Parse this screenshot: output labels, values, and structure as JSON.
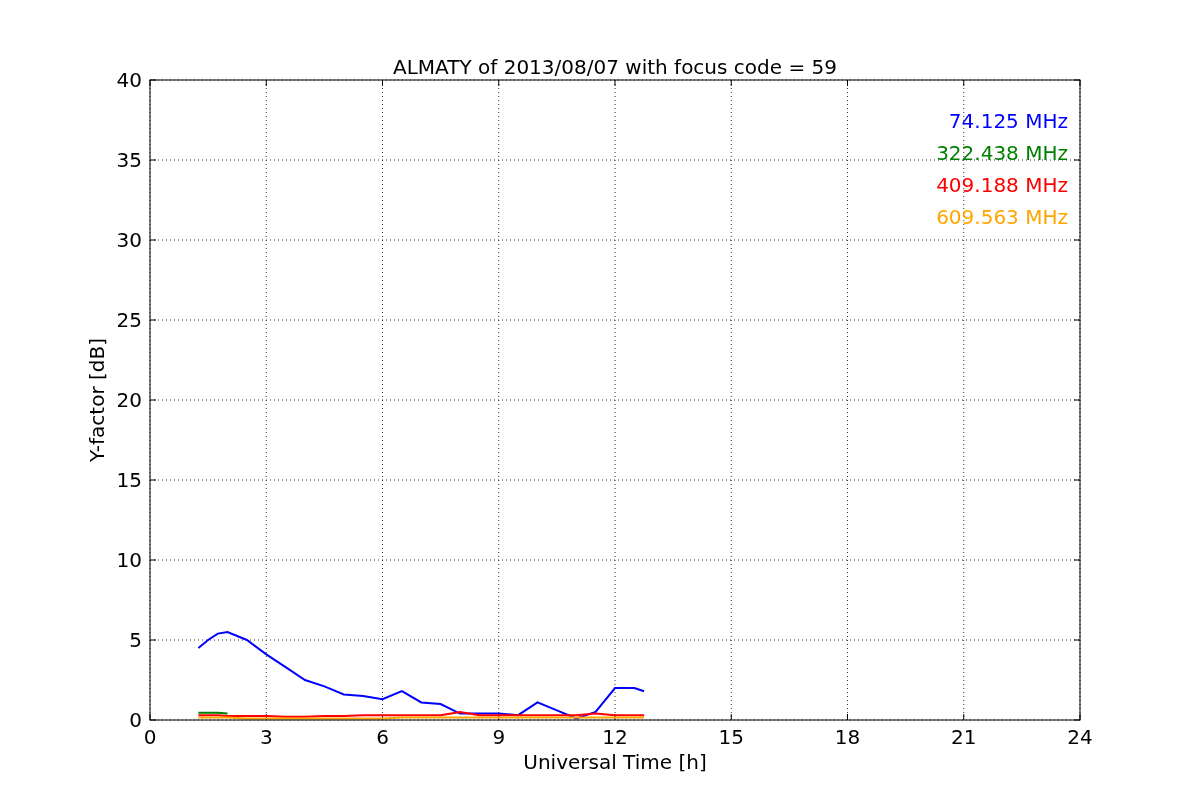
{
  "chart_data": {
    "type": "line",
    "title": "ALMATY of 2013/08/07 with focus code = 59",
    "xlabel": "Universal Time [h]",
    "ylabel": "Y-factor [dB]",
    "x": [
      1.25,
      1.5,
      1.75,
      2.0,
      2.5,
      3.0,
      3.5,
      4.0,
      4.5,
      5.0,
      5.5,
      6.0,
      6.5,
      7.0,
      7.5,
      8.0,
      8.5,
      9.0,
      9.5,
      10.0,
      10.5,
      11.0,
      11.5,
      12.0,
      12.5,
      12.75
    ],
    "series": [
      {
        "name": "74.125 MHz",
        "color": "#0000ff",
        "values": [
          4.5,
          5.0,
          5.4,
          5.5,
          5.0,
          4.1,
          3.3,
          2.5,
          2.1,
          1.6,
          1.5,
          1.3,
          1.8,
          1.1,
          1.0,
          0.4,
          0.4,
          0.4,
          0.3,
          1.1,
          0.6,
          0.1,
          0.5,
          2.0,
          2.0,
          1.8
        ]
      },
      {
        "name": "322.438 MHz",
        "color": "#008000",
        "values": [
          0.45,
          0.45,
          0.45,
          0.4,
          null,
          null,
          null,
          null,
          null,
          null,
          null,
          null,
          null,
          null,
          null,
          null,
          null,
          null,
          null,
          null,
          null,
          null,
          null,
          null,
          null,
          null
        ]
      },
      {
        "name": "409.188 MHz",
        "color": "#ff0000",
        "values": [
          0.3,
          0.3,
          0.3,
          0.25,
          0.25,
          0.25,
          0.2,
          0.2,
          0.25,
          0.25,
          0.3,
          0.3,
          0.3,
          0.3,
          0.3,
          0.5,
          0.3,
          0.3,
          0.3,
          0.3,
          0.3,
          0.3,
          0.4,
          0.3,
          0.3,
          0.3
        ]
      },
      {
        "name": "609.563 MHz",
        "color": "#ffa500",
        "values": [
          0.15,
          0.15,
          0.15,
          0.15,
          0.1,
          0.1,
          0.1,
          0.1,
          0.1,
          0.1,
          0.1,
          0.1,
          0.15,
          0.15,
          0.15,
          0.15,
          0.15,
          0.15,
          0.15,
          0.15,
          0.15,
          0.15,
          0.15,
          0.15,
          0.15,
          0.15
        ]
      }
    ],
    "grid": true,
    "xlim": [
      0,
      24
    ],
    "ylim": [
      0,
      40
    ],
    "xticks": [
      0,
      3,
      6,
      9,
      12,
      15,
      18,
      21,
      24
    ],
    "yticks": [
      0,
      5,
      10,
      15,
      20,
      25,
      30,
      35,
      40
    ]
  }
}
